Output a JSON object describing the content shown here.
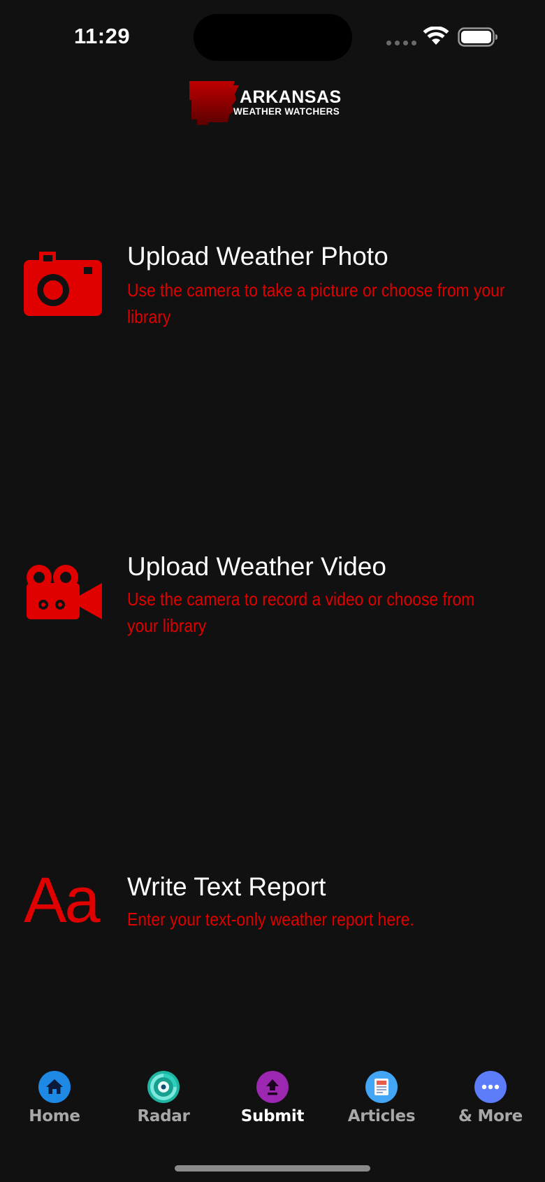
{
  "status_bar": {
    "time": "11:29"
  },
  "logo": {
    "line1": "ARKANSAS",
    "line2": "WEATHER WATCHERS"
  },
  "options": [
    {
      "icon": "camera-icon",
      "title": "Upload Weather Photo",
      "description": "Use the camera to take a picture or choose from your library"
    },
    {
      "icon": "video-camera-icon",
      "title": "Upload Weather Video",
      "description": "Use the camera to record a video or choose from your library"
    },
    {
      "icon": "text-aa-icon",
      "icon_text": "Aa",
      "title": "Write Text Report",
      "description": "Enter your text-only weather report here."
    }
  ],
  "tabs": [
    {
      "label": "Home",
      "icon": "home-icon",
      "color": "#1e88e5"
    },
    {
      "label": "Radar",
      "icon": "radar-icon",
      "color": "#26c6b4"
    },
    {
      "label": "Submit",
      "icon": "upload-icon",
      "color": "#9c27b0",
      "active": true
    },
    {
      "label": "Articles",
      "icon": "newspaper-icon",
      "color": "#42a5f5"
    },
    {
      "label": "& More",
      "icon": "more-icon",
      "color": "#5c7cfa"
    }
  ],
  "colors": {
    "background": "#111111",
    "accent_red": "#e00000",
    "text_white": "#ffffff",
    "tab_inactive": "#a8a8a8"
  }
}
